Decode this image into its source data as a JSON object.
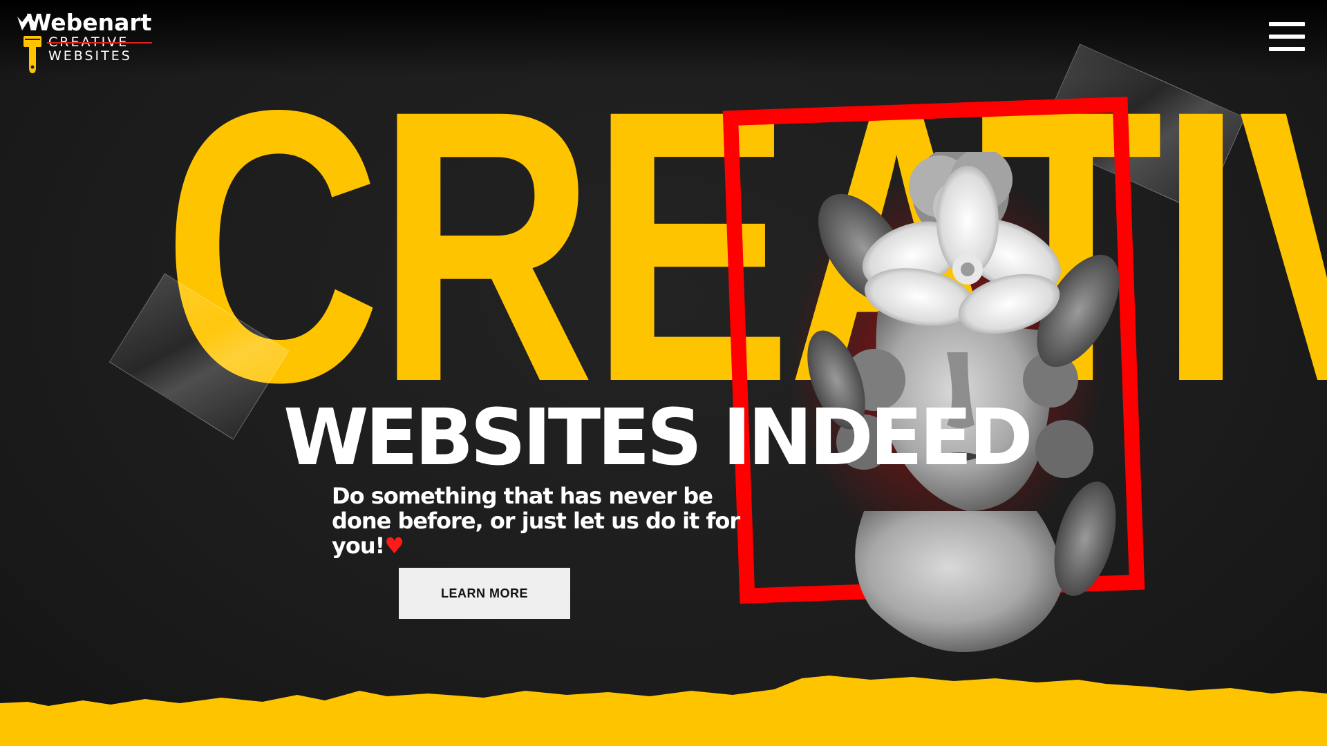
{
  "brand": {
    "wordmark": "Webenart",
    "line1": "CREATIVE",
    "line2": "WEBSITES"
  },
  "nav": {
    "menu_icon": "hamburger-menu-icon"
  },
  "hero": {
    "headline": "CREATIVE",
    "subheadline": "WEBSITES INDEED",
    "tagline": "Do something that has never be done before, or just let us do it for you!",
    "heart_icon": "heart-icon",
    "cta_label": "LEARN MORE"
  },
  "colors": {
    "background": "#1e1e1e",
    "accent_yellow": "#ffc400",
    "frame_red": "#ff0000",
    "text_white": "#ffffff",
    "button_bg": "#efefef"
  }
}
